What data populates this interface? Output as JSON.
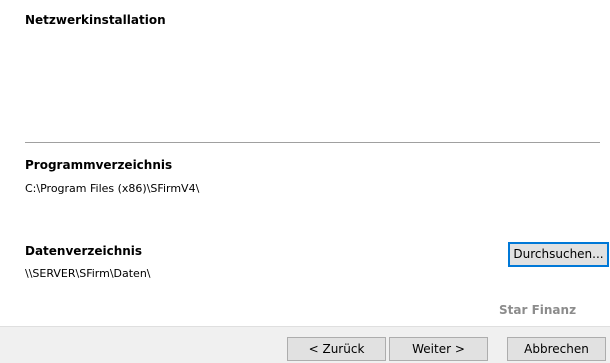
{
  "dialog": {
    "title": "Netzwerkinstallation",
    "program_dir": {
      "heading": "Programmverzeichnis",
      "path": "C:\\Program Files (x86)\\SFirmV4\\"
    },
    "data_dir": {
      "heading": "Datenverzeichnis",
      "path": "\\\\SERVER\\SFirm\\Daten\\",
      "browse_label": "Durchsuchen..."
    },
    "brand": "Star Finanz"
  },
  "footer": {
    "back_label": "< Zurück",
    "next_label": "Weiter >",
    "cancel_label": "Abbrechen"
  },
  "colors": {
    "focus_border": "#0078d7",
    "button_bg": "#e1e1e1",
    "footer_bg": "#f0f0f0",
    "brand_text": "#8c8c8c"
  }
}
